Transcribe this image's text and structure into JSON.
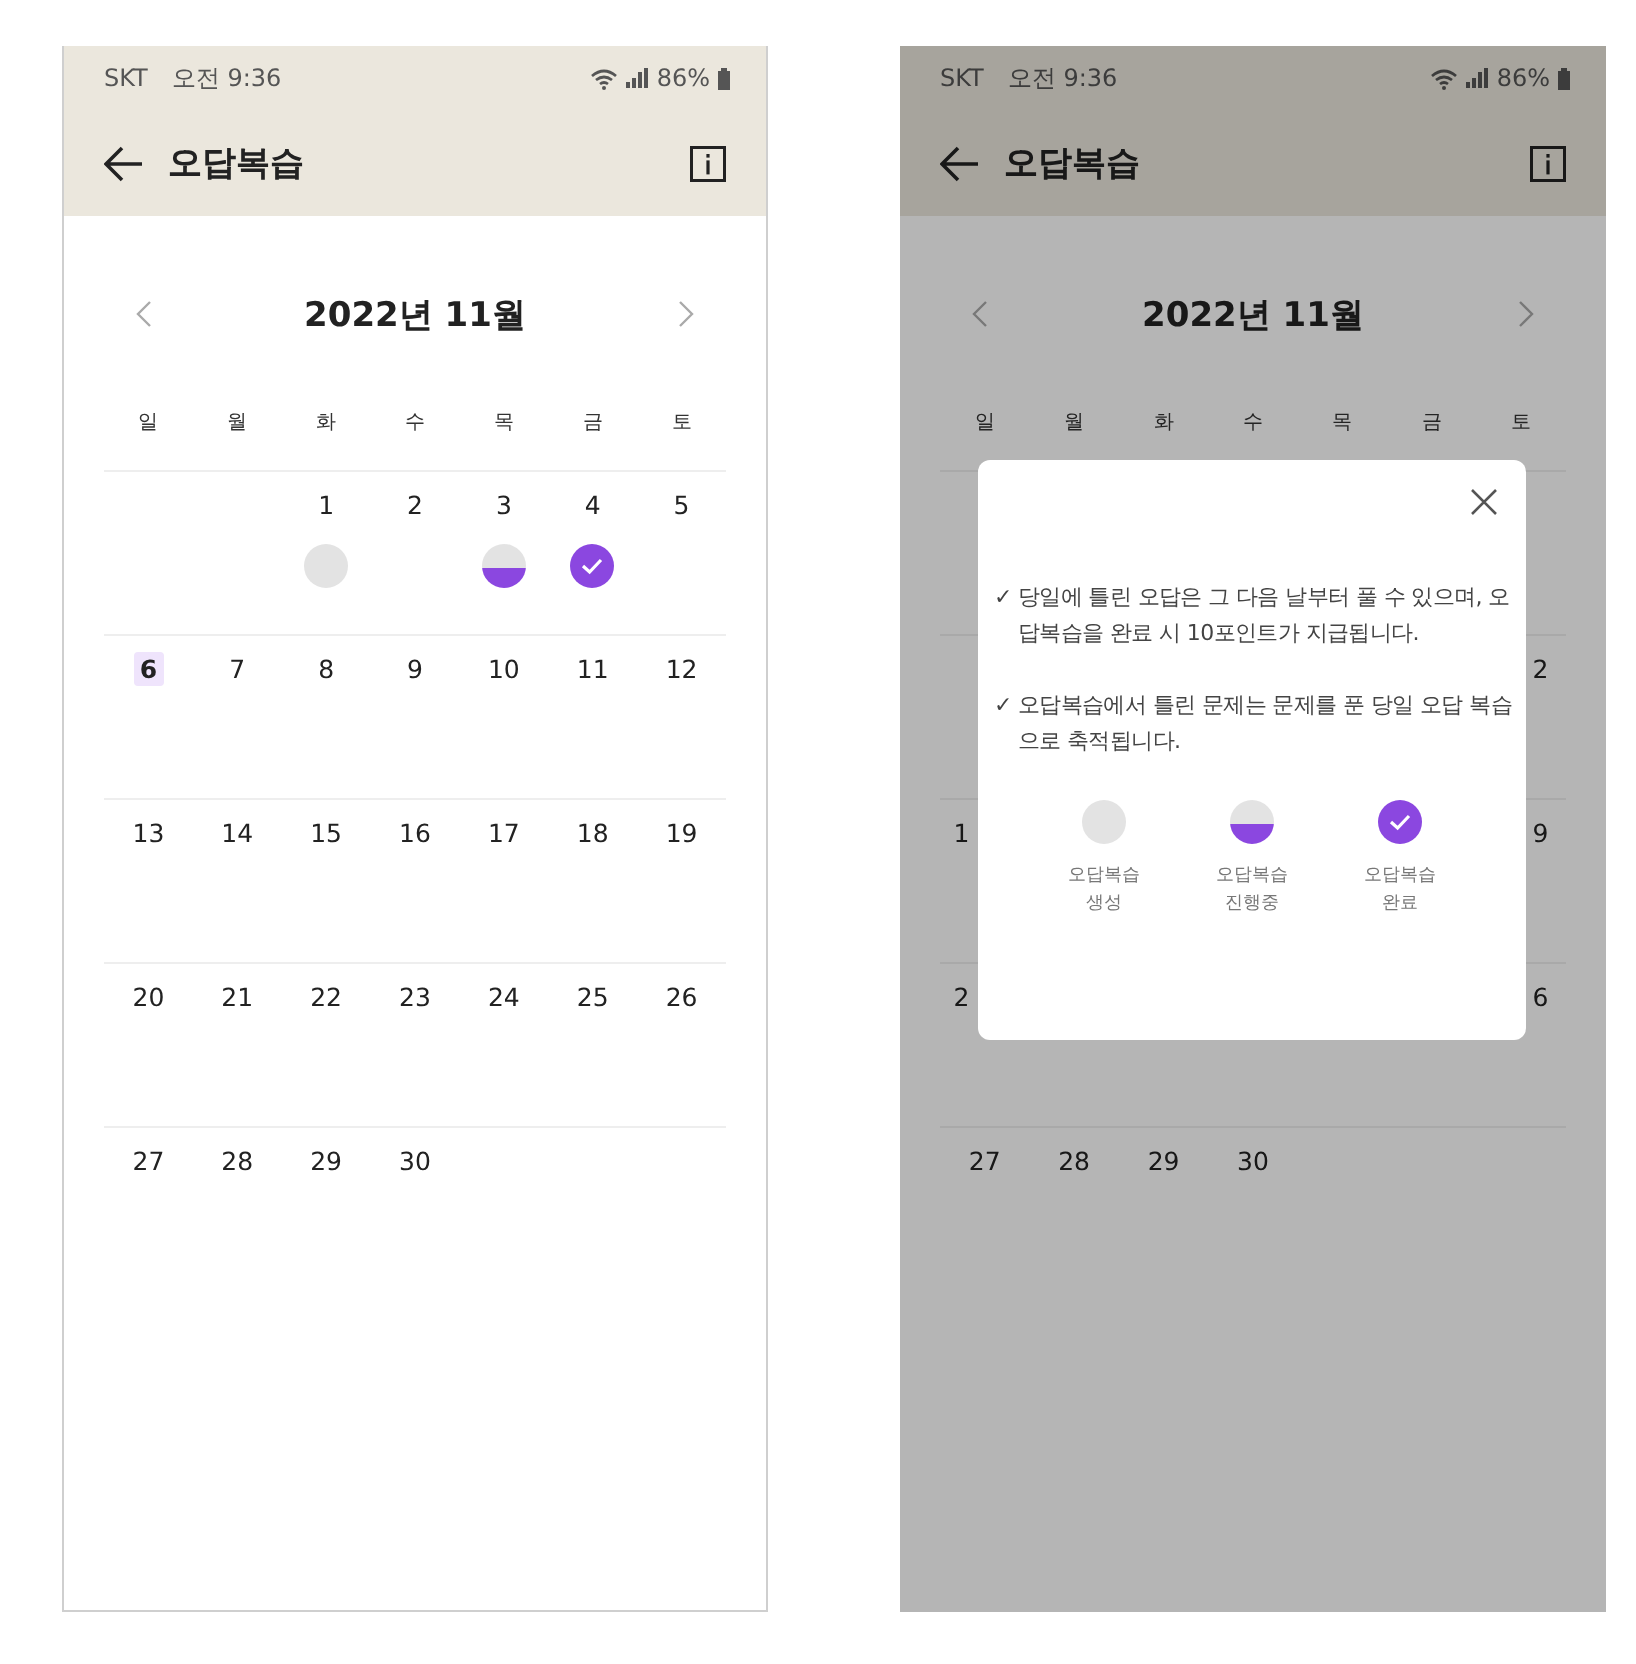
{
  "screens": [
    {
      "status_bar": {
        "carrier": "SKT",
        "time": "오전 9:36",
        "battery": "86%"
      },
      "app_bar": {
        "title": "오답복습"
      },
      "calendar": {
        "title": "2022년 11월",
        "weekdays": [
          "일",
          "월",
          "화",
          "수",
          "목",
          "금",
          "토"
        ],
        "weeks": [
          [
            {
              "kind": "blank"
            },
            {
              "kind": "blank"
            },
            {
              "day": "1",
              "kind": "created"
            },
            {
              "day": "2",
              "kind": "plain"
            },
            {
              "day": "3",
              "kind": "in_progress"
            },
            {
              "day": "4",
              "kind": "done"
            },
            {
              "day": "5",
              "kind": "plain"
            }
          ],
          [
            {
              "day": "6",
              "kind": "plain",
              "today": true
            },
            {
              "day": "7",
              "kind": "plain"
            },
            {
              "day": "8",
              "kind": "plain"
            },
            {
              "day": "9",
              "kind": "plain"
            },
            {
              "day": "10",
              "kind": "plain"
            },
            {
              "day": "11",
              "kind": "plain"
            },
            {
              "day": "12",
              "kind": "plain"
            }
          ],
          [
            {
              "day": "13",
              "kind": "plain"
            },
            {
              "day": "14",
              "kind": "plain"
            },
            {
              "day": "15",
              "kind": "plain"
            },
            {
              "day": "16",
              "kind": "plain"
            },
            {
              "day": "17",
              "kind": "plain"
            },
            {
              "day": "18",
              "kind": "plain"
            },
            {
              "day": "19",
              "kind": "plain"
            }
          ],
          [
            {
              "day": "20",
              "kind": "plain"
            },
            {
              "day": "21",
              "kind": "plain"
            },
            {
              "day": "22",
              "kind": "plain"
            },
            {
              "day": "23",
              "kind": "plain"
            },
            {
              "day": "24",
              "kind": "plain"
            },
            {
              "day": "25",
              "kind": "plain"
            },
            {
              "day": "26",
              "kind": "plain"
            }
          ],
          [
            {
              "day": "27",
              "kind": "plain"
            },
            {
              "day": "28",
              "kind": "plain"
            },
            {
              "day": "29",
              "kind": "plain"
            },
            {
              "day": "30",
              "kind": "plain"
            },
            {
              "kind": "blank"
            },
            {
              "kind": "blank"
            },
            {
              "kind": "blank"
            }
          ]
        ]
      }
    },
    {
      "status_bar": {
        "carrier": "SKT",
        "time": "오전 9:36",
        "battery": "86%"
      },
      "app_bar": {
        "title": "오답복습"
      },
      "calendar": {
        "title": "2022년 11월",
        "weekdays": [
          "일",
          "월",
          "화",
          "수",
          "목",
          "금",
          "토"
        ],
        "weeks": [
          [
            {
              "kind": "blank"
            },
            {
              "kind": "blank"
            },
            {
              "kind": "blank"
            },
            {
              "kind": "blank"
            },
            {
              "kind": "blank"
            },
            {
              "kind": "blank"
            },
            {
              "kind": "blank"
            }
          ],
          [
            {
              "kind": "blank"
            },
            {
              "kind": "blank"
            },
            {
              "kind": "blank"
            },
            {
              "kind": "blank"
            },
            {
              "kind": "blank"
            },
            {
              "kind": "blank"
            },
            {
              "day": "2",
              "kind": "clip_head"
            }
          ],
          [
            {
              "day": "1",
              "kind": "clip_tail"
            },
            {
              "kind": "blank"
            },
            {
              "kind": "blank"
            },
            {
              "kind": "blank"
            },
            {
              "kind": "blank"
            },
            {
              "kind": "blank"
            },
            {
              "day": "9",
              "kind": "clip_head"
            }
          ],
          [
            {
              "day": "2",
              "kind": "clip_tail"
            },
            {
              "kind": "blank"
            },
            {
              "kind": "blank"
            },
            {
              "kind": "blank"
            },
            {
              "kind": "blank"
            },
            {
              "kind": "blank"
            },
            {
              "day": "6",
              "kind": "clip_head"
            }
          ],
          [
            {
              "day": "27",
              "kind": "plain"
            },
            {
              "day": "28",
              "kind": "plain"
            },
            {
              "day": "29",
              "kind": "plain"
            },
            {
              "day": "30",
              "kind": "plain"
            },
            {
              "kind": "blank"
            },
            {
              "kind": "blank"
            },
            {
              "kind": "blank"
            }
          ]
        ]
      },
      "dialog": {
        "notes": [
          {
            "mark": "✓",
            "text": "당일에 틀린 오답은 그 다음 날부터 풀 수 있으며, 오답복습을 완료 시 10포인트가 지급됩니다."
          },
          {
            "mark": "✓",
            "text": "오답복습에서 틀린 문제는 문제를 푼 당일 오답 복습으로 축적됩니다."
          }
        ],
        "legend": [
          {
            "kind": "created",
            "lines": [
              "오답복습",
              "생성"
            ]
          },
          {
            "kind": "in_progress",
            "lines": [
              "오답복습",
              "진행중"
            ]
          },
          {
            "kind": "done",
            "lines": [
              "오답복습",
              "완료"
            ]
          }
        ]
      }
    }
  ]
}
